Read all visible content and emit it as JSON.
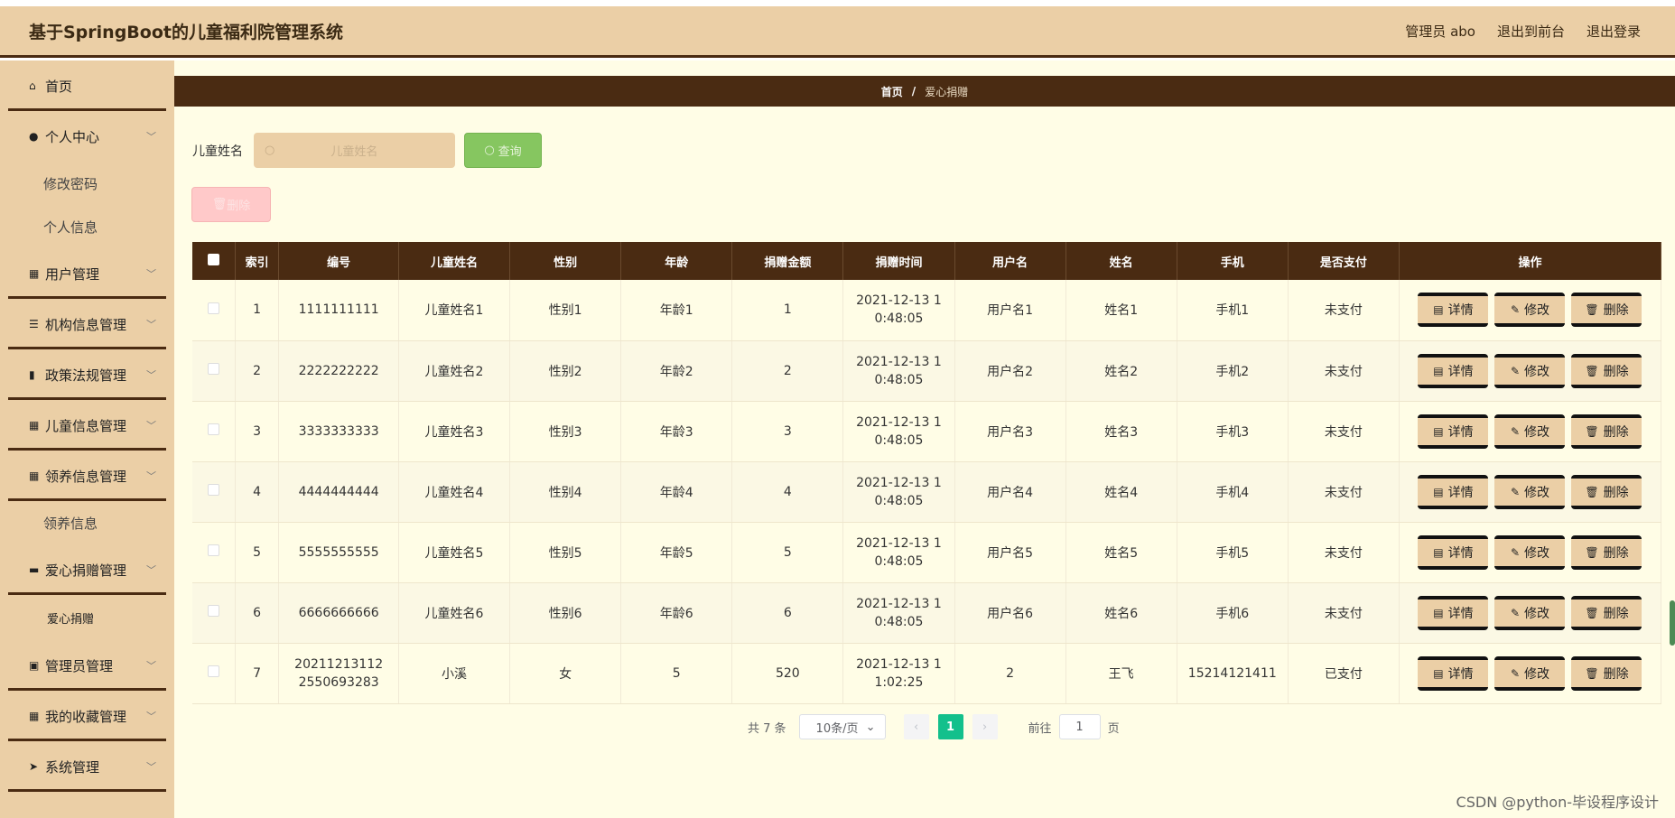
{
  "header": {
    "title": "基于SpringBoot的儿童福利院管理系统",
    "admin": "管理员 abo",
    "to_front": "退出到前台",
    "logout": "退出登录"
  },
  "sidebar": {
    "home": "首页",
    "personal": "个人中心",
    "change_pwd": "修改密码",
    "profile": "个人信息",
    "user_mgmt": "用户管理",
    "org_mgmt": "机构信息管理",
    "policy_mgmt": "政策法规管理",
    "child_mgmt": "儿童信息管理",
    "adopt_mgmt": "领养信息管理",
    "adopt_info": "领养信息",
    "donate_mgmt": "爱心捐赠管理",
    "donate": "爱心捐赠",
    "admin_mgmt": "管理员管理",
    "fav_mgmt": "我的收藏管理",
    "sys_mgmt": "系统管理"
  },
  "breadcrumb": {
    "home": "首页",
    "sep": "/",
    "current": "爱心捐赠"
  },
  "search": {
    "label": "儿童姓名",
    "placeholder": "儿童姓名",
    "query": "查询",
    "delete": "删除"
  },
  "table": {
    "headers": [
      "索引",
      "编号",
      "儿童姓名",
      "性别",
      "年龄",
      "捐赠金额",
      "捐赠时间",
      "用户名",
      "姓名",
      "手机",
      "是否支付",
      "操作"
    ],
    "rows": [
      [
        "1",
        "1111111111",
        "儿童姓名1",
        "性别1",
        "年龄1",
        "1",
        "2021-12-13 10:48:05",
        "用户名1",
        "姓名1",
        "手机1",
        "未支付"
      ],
      [
        "2",
        "2222222222",
        "儿童姓名2",
        "性别2",
        "年龄2",
        "2",
        "2021-12-13 10:48:05",
        "用户名2",
        "姓名2",
        "手机2",
        "未支付"
      ],
      [
        "3",
        "3333333333",
        "儿童姓名3",
        "性别3",
        "年龄3",
        "3",
        "2021-12-13 10:48:05",
        "用户名3",
        "姓名3",
        "手机3",
        "未支付"
      ],
      [
        "4",
        "4444444444",
        "儿童姓名4",
        "性别4",
        "年龄4",
        "4",
        "2021-12-13 10:48:05",
        "用户名4",
        "姓名4",
        "手机4",
        "未支付"
      ],
      [
        "5",
        "5555555555",
        "儿童姓名5",
        "性别5",
        "年龄5",
        "5",
        "2021-12-13 10:48:05",
        "用户名5",
        "姓名5",
        "手机5",
        "未支付"
      ],
      [
        "6",
        "6666666666",
        "儿童姓名6",
        "性别6",
        "年龄6",
        "6",
        "2021-12-13 10:48:05",
        "用户名6",
        "姓名6",
        "手机6",
        "未支付"
      ],
      [
        "7",
        "202112131122550693283",
        "小溪",
        "女",
        "5",
        "520",
        "2021-12-13 11:02:25",
        "2",
        "王飞",
        "15214121411",
        "已支付"
      ]
    ],
    "actions": {
      "detail": "详情",
      "edit": "修改",
      "delete": "删除"
    }
  },
  "pager": {
    "total": "共 7 条",
    "size": "10条/页",
    "current": "1",
    "goto": "前往",
    "page_value": "1",
    "page_word": "页"
  },
  "watermark": "CSDN @python-毕设程序设计",
  "colors": {
    "accent": "#4a2b12",
    "sidebar": "#ebcfa6",
    "content_bg": "#fffde6",
    "query_btn": "#86c660",
    "active_page": "#13c08c"
  }
}
